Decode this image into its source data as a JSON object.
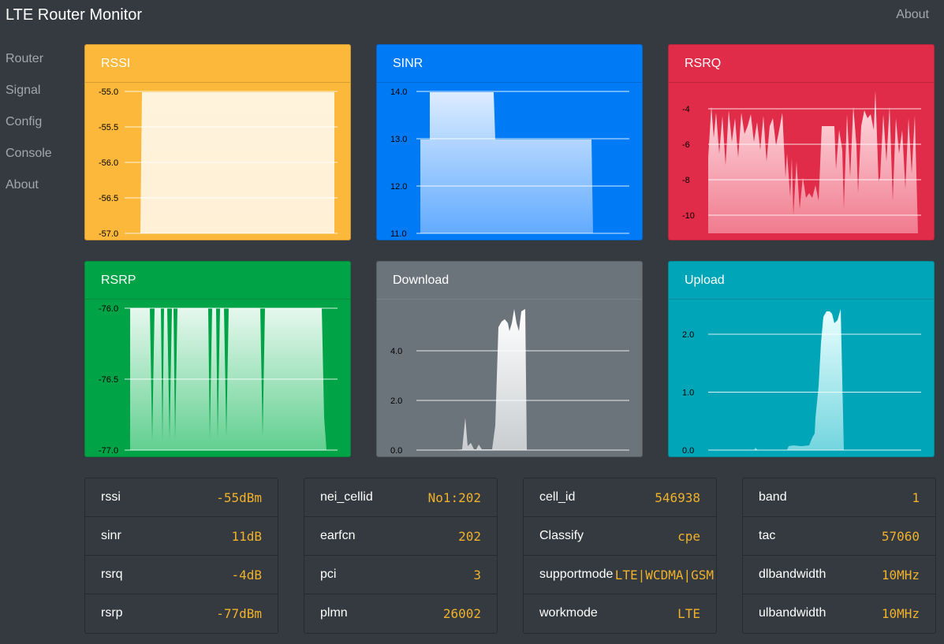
{
  "app": {
    "title": "LTE Router Monitor",
    "top_link": "About"
  },
  "sidebar": {
    "items": [
      {
        "label": "Router"
      },
      {
        "label": "Signal"
      },
      {
        "label": "Config"
      },
      {
        "label": "Console"
      },
      {
        "label": "About"
      }
    ]
  },
  "colors": {
    "rssi": "#fbb83a",
    "sinr": "#007bf5",
    "rsrq": "#e02c48",
    "rsrp": "#00a346",
    "download": "#6c747b",
    "upload": "#00a5b7",
    "value_text": "#f0b12b"
  },
  "chart_data": [
    {
      "id": "rssi",
      "type": "area",
      "title": "RSSI",
      "ylim": [
        -57.0,
        -55.0
      ],
      "yticks": [
        "-55.0",
        "-55.5",
        "-56.0",
        "-56.5",
        "-57.0"
      ],
      "fill": [
        "#fff3dc",
        "#fff0d6"
      ],
      "grid": true
    },
    {
      "id": "sinr",
      "type": "area",
      "title": "SINR",
      "ylim": [
        11.0,
        14.0
      ],
      "yticks": [
        "14.0",
        "13.0",
        "12.0",
        "11.0"
      ],
      "fill": [
        "#dcecff",
        "#62abff"
      ],
      "grid": true
    },
    {
      "id": "rsrq",
      "type": "area",
      "title": "RSRQ",
      "ylim": [
        -11.0,
        -2.9
      ],
      "yticks": [
        "-4",
        "-6",
        "-8",
        "-10"
      ],
      "fill": [
        "#ffe2e6",
        "#f07b8f"
      ],
      "grid": true
    },
    {
      "id": "rsrp",
      "type": "area",
      "title": "RSRP",
      "ylim": [
        -77.0,
        -76.0
      ],
      "yticks": [
        "-76.0",
        "-76.5",
        "-77.0"
      ],
      "fill": [
        "#e6f8ee",
        "#61cf8f"
      ],
      "grid": true
    },
    {
      "id": "download",
      "type": "area",
      "title": "Download",
      "ylim": [
        0.0,
        6.0
      ],
      "yticks": [
        "4.0",
        "2.0",
        "0.0"
      ],
      "fill": [
        "#ffffff",
        "#c9cdd0"
      ],
      "grid": true
    },
    {
      "id": "upload",
      "type": "area",
      "title": "Upload",
      "ylim": [
        0.0,
        2.6
      ],
      "yticks": [
        "2.0",
        "1.0",
        "0.0"
      ],
      "fill": [
        "#eaffff",
        "#74d5df"
      ],
      "grid": true
    }
  ],
  "stats": [
    [
      {
        "key": "rssi",
        "value": "-55dBm"
      },
      {
        "key": "sinr",
        "value": "11dB"
      },
      {
        "key": "rsrq",
        "value": "-4dB"
      },
      {
        "key": "rsrp",
        "value": "-77dBm"
      }
    ],
    [
      {
        "key": "nei_cellid",
        "value": "No1:202"
      },
      {
        "key": "earfcn",
        "value": "202"
      },
      {
        "key": "pci",
        "value": "3"
      },
      {
        "key": "plmn",
        "value": "26002"
      }
    ],
    [
      {
        "key": "cell_id",
        "value": "546938"
      },
      {
        "key": "Classify",
        "value": "cpe"
      },
      {
        "key": "supportmode",
        "value": "LTE|WCDMA|GSM"
      },
      {
        "key": "workmode",
        "value": "LTE"
      }
    ],
    [
      {
        "key": "band",
        "value": "1"
      },
      {
        "key": "tac",
        "value": "57060"
      },
      {
        "key": "dlbandwidth",
        "value": "10MHz"
      },
      {
        "key": "ulbandwidth",
        "value": "10MHz"
      }
    ]
  ]
}
